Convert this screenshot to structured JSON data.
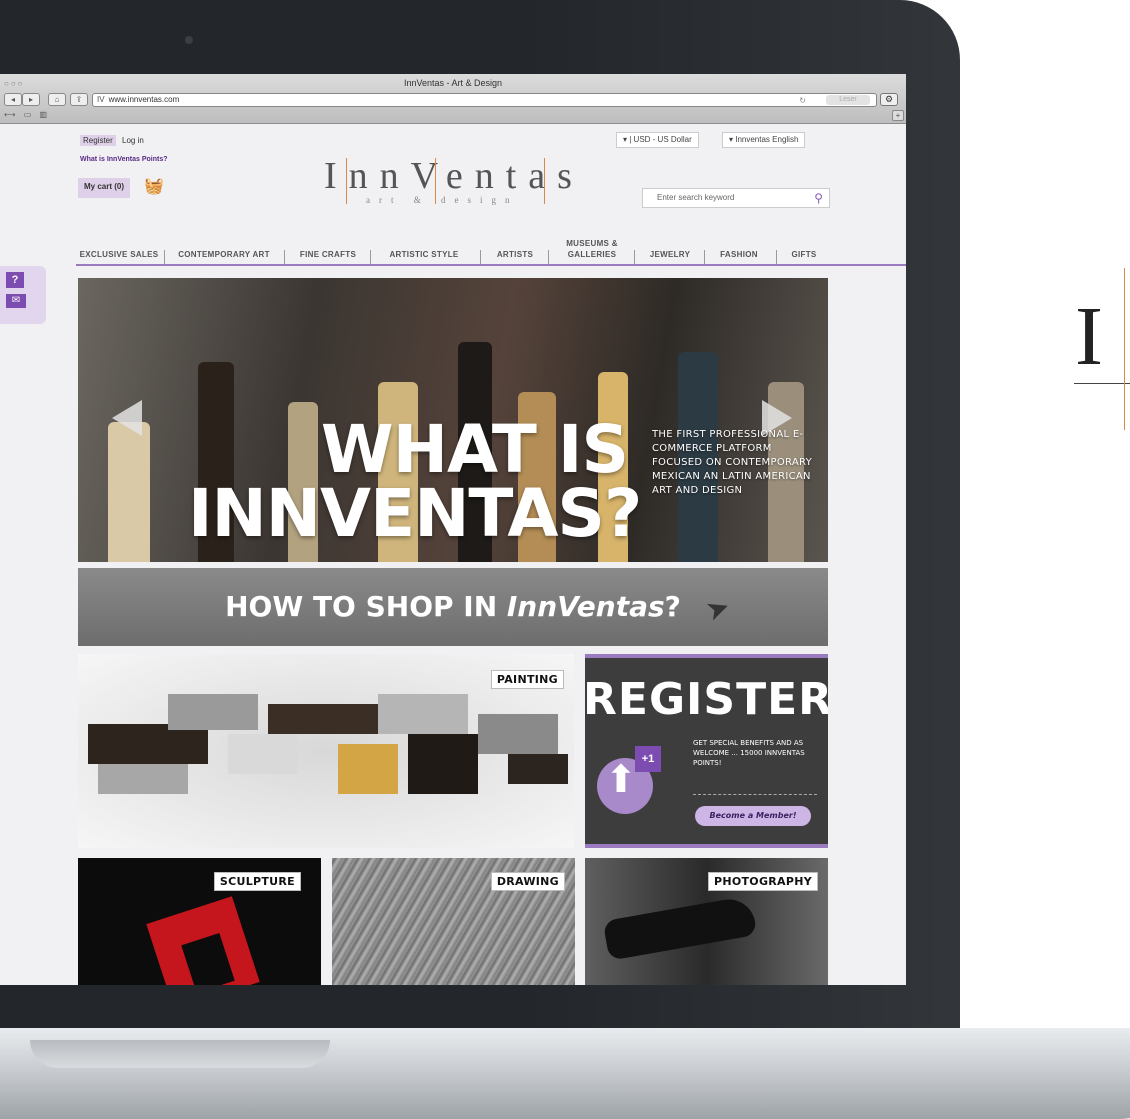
{
  "browser": {
    "window_title": "InnVentas - Art & Design",
    "url": "www.innventas.com",
    "reader_label": "Leser"
  },
  "header": {
    "register_label": "Register",
    "login_label": "Log in",
    "points_link": "What is InnVentas Points?",
    "cart_label": "My cart (0)",
    "logo_text": "InnVentas",
    "logo_subtitle": "art & design",
    "currency": "▾ | USD - US Dollar",
    "language": "▾  Innventas English",
    "search_placeholder": "Enter search keyword"
  },
  "nav": {
    "items": [
      {
        "label": "EXCLUSIVE SALES"
      },
      {
        "label": "CONTEMPORARY ART"
      },
      {
        "label": "FINE CRAFTS"
      },
      {
        "label": "ARTISTIC STYLE"
      },
      {
        "label": "ARTISTS"
      },
      {
        "label": "MUSEUMS & GALLERIES"
      },
      {
        "label": "JEWELRY"
      },
      {
        "label": "FASHION"
      },
      {
        "label": "GIFTS"
      }
    ]
  },
  "side_widget": {
    "help_glyph": "?",
    "mail_glyph": "✉"
  },
  "hero": {
    "title_line1": "WHAT IS",
    "title_line2": "INNVENTAS?",
    "side_text": "THE FIRST PROFESSIONAL E-COMMERCE PLATFORM FOCUSED ON CONTEMPORARY MEXICAN AN LATIN AMERICAN ART AND DESIGN"
  },
  "banner": {
    "text_prefix": "HOW TO SHOP IN ",
    "text_brand": "InnVentas",
    "text_suffix": "?"
  },
  "tiles": {
    "painting": "PAINTING",
    "register_title": "REGISTER",
    "register_plus": "+1",
    "register_text": "GET SPECIAL BENEFITS AND AS WELCOME ... 15000 INNVENTAS POINTS!",
    "register_button": "Become a Member!",
    "sculpture": "SCULPTURE",
    "drawing": "DRAWING",
    "photography": "PHOTOGRAPHY"
  },
  "side_logo": {
    "letter": "I"
  },
  "colors": {
    "brand_purple": "#7d4cb0",
    "accent_lilac": "#ddd0e8",
    "logo_orange": "#d9894a"
  }
}
